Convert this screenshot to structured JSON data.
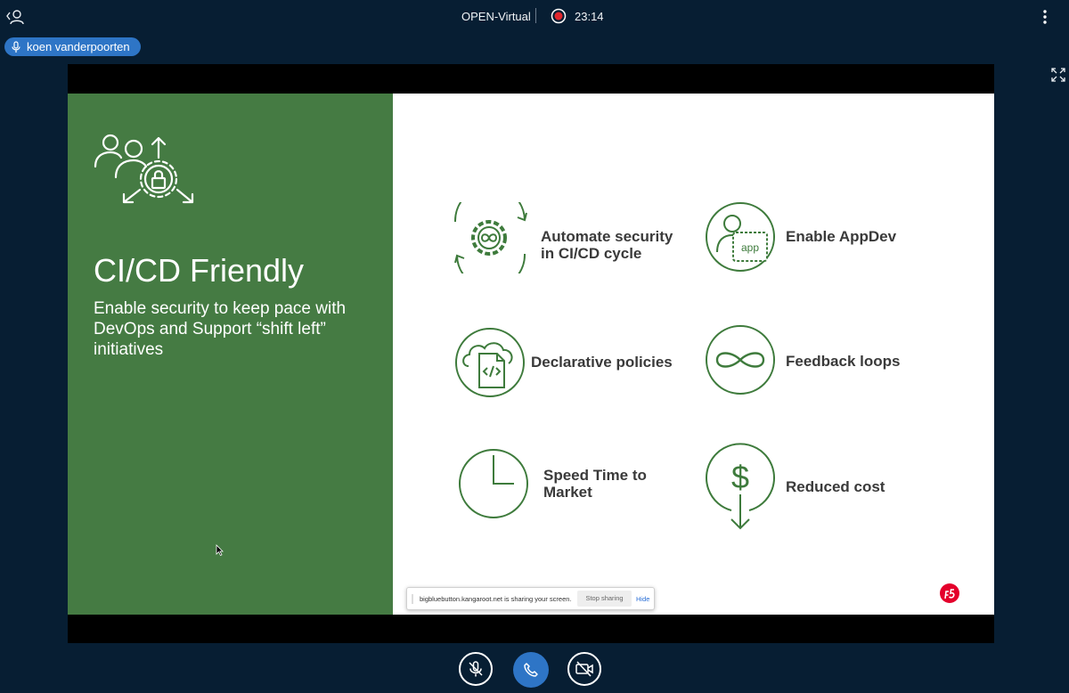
{
  "topbar": {
    "meeting_title": "OPEN-Virtual",
    "recording_time": "23:14",
    "icons": {
      "users": "users-icon",
      "recording": "record-icon",
      "options": "kebab-menu-icon"
    }
  },
  "talking_indicator": {
    "name": "koen vanderpoorten",
    "icon": "microphone-icon"
  },
  "slide": {
    "title": "CI/CD Friendly",
    "subtitle": "Enable security to keep pace with DevOps and Support “shift left” initiatives",
    "features": [
      {
        "label_lines": [
          "Automate security",
          "in CI/CD cycle"
        ],
        "icon": "gear-infinity-icon"
      },
      {
        "label_lines": [
          "Enable AppDev"
        ],
        "icon": "developer-app-icon",
        "icon_text": "app"
      },
      {
        "label_lines": [
          "Declarative policies"
        ],
        "icon": "cloud-code-icon"
      },
      {
        "label_lines": [
          "Feedback loops"
        ],
        "icon": "infinity-loop-icon"
      },
      {
        "label_lines": [
          "Speed Time to",
          "Market"
        ],
        "icon": "clock-icon"
      },
      {
        "label_lines": [
          "Reduced cost"
        ],
        "icon": "dollar-down-icon"
      }
    ],
    "colors": {
      "panel": "#457b43",
      "icon_stroke": "#3e7b3c",
      "label": "#3a3a3a"
    }
  },
  "share_bar": {
    "message": "bigbluebutton.kangaroot.net is sharing your screen.",
    "stop_label": "Stop sharing",
    "hide_label": "Hide"
  },
  "controls": {
    "mic": "microphone-muted-icon",
    "leave": "phone-icon",
    "camera": "camera-off-icon"
  },
  "colors": {
    "background": "#071e33",
    "accent": "#2e75c6"
  }
}
